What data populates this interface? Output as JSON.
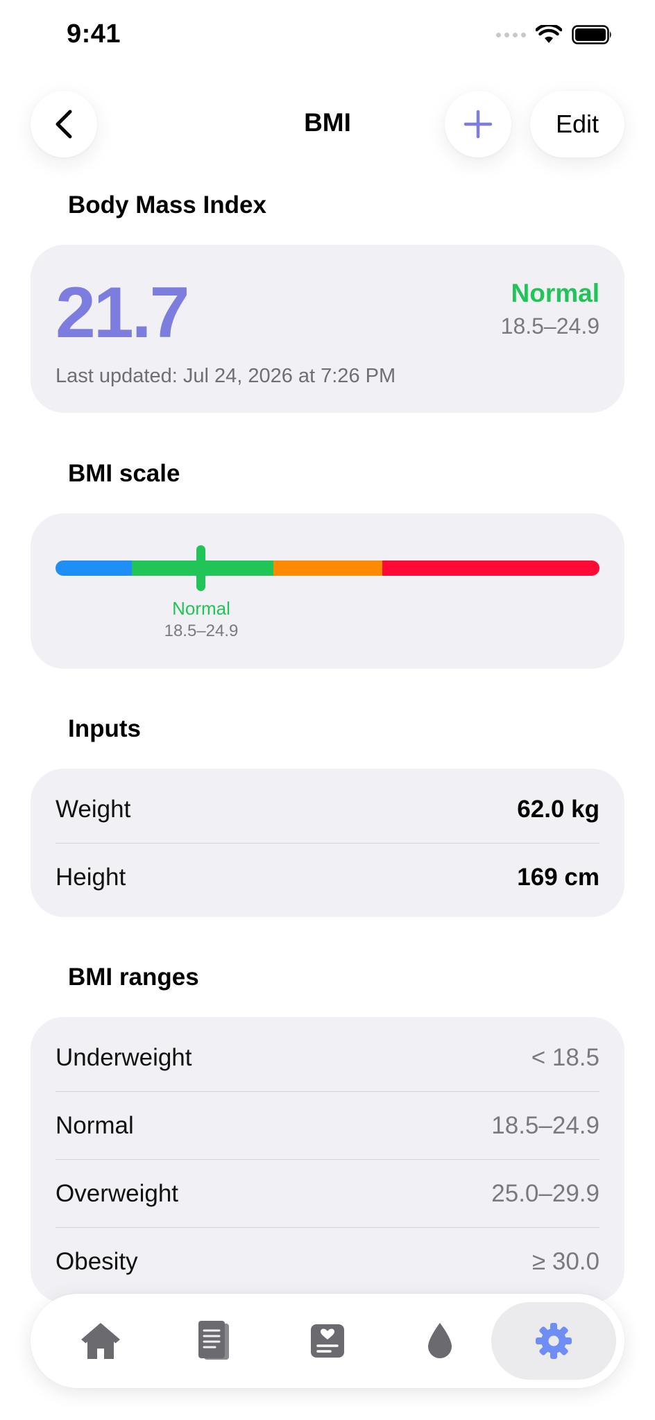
{
  "status_bar": {
    "time": "9:41"
  },
  "nav": {
    "title": "BMI",
    "edit_label": "Edit"
  },
  "summary": {
    "section_title": "Body Mass Index",
    "value": "21.7",
    "category": "Normal",
    "category_range": "18.5–24.9",
    "last_updated": "Last updated: Jul 24, 2026 at 7:26 PM"
  },
  "scale": {
    "section_title": "BMI scale",
    "marker_label": "Normal",
    "marker_range": "18.5–24.9",
    "current_value": 21.7,
    "segments": [
      {
        "name": "Underweight",
        "color": "#1e8ff7"
      },
      {
        "name": "Normal",
        "color": "#21c456"
      },
      {
        "name": "Overweight",
        "color": "#ff8a00"
      },
      {
        "name": "Obesity",
        "color": "#ff0a35"
      }
    ]
  },
  "inputs": {
    "section_title": "Inputs",
    "rows": [
      {
        "label": "Weight",
        "value": "62.0 kg"
      },
      {
        "label": "Height",
        "value": "169 cm"
      }
    ]
  },
  "ranges": {
    "section_title": "BMI ranges",
    "rows": [
      {
        "label": "Underweight",
        "value": "< 18.5"
      },
      {
        "label": "Normal",
        "value": "18.5–24.9"
      },
      {
        "label": "Overweight",
        "value": "25.0–29.9"
      },
      {
        "label": "Obesity",
        "value": "≥ 30.0"
      }
    ]
  },
  "tabbar": {
    "tabs": [
      {
        "icon": "home-icon"
      },
      {
        "icon": "journal-icon"
      },
      {
        "icon": "health-card-icon"
      },
      {
        "icon": "drop-icon"
      },
      {
        "icon": "gear-icon",
        "active": true
      }
    ]
  },
  "colors": {
    "accent": "#7d7ddf",
    "normal": "#21c456",
    "active_tab_icon": "#6f8ef5",
    "inactive_tab_icon": "#6b6b6f"
  }
}
